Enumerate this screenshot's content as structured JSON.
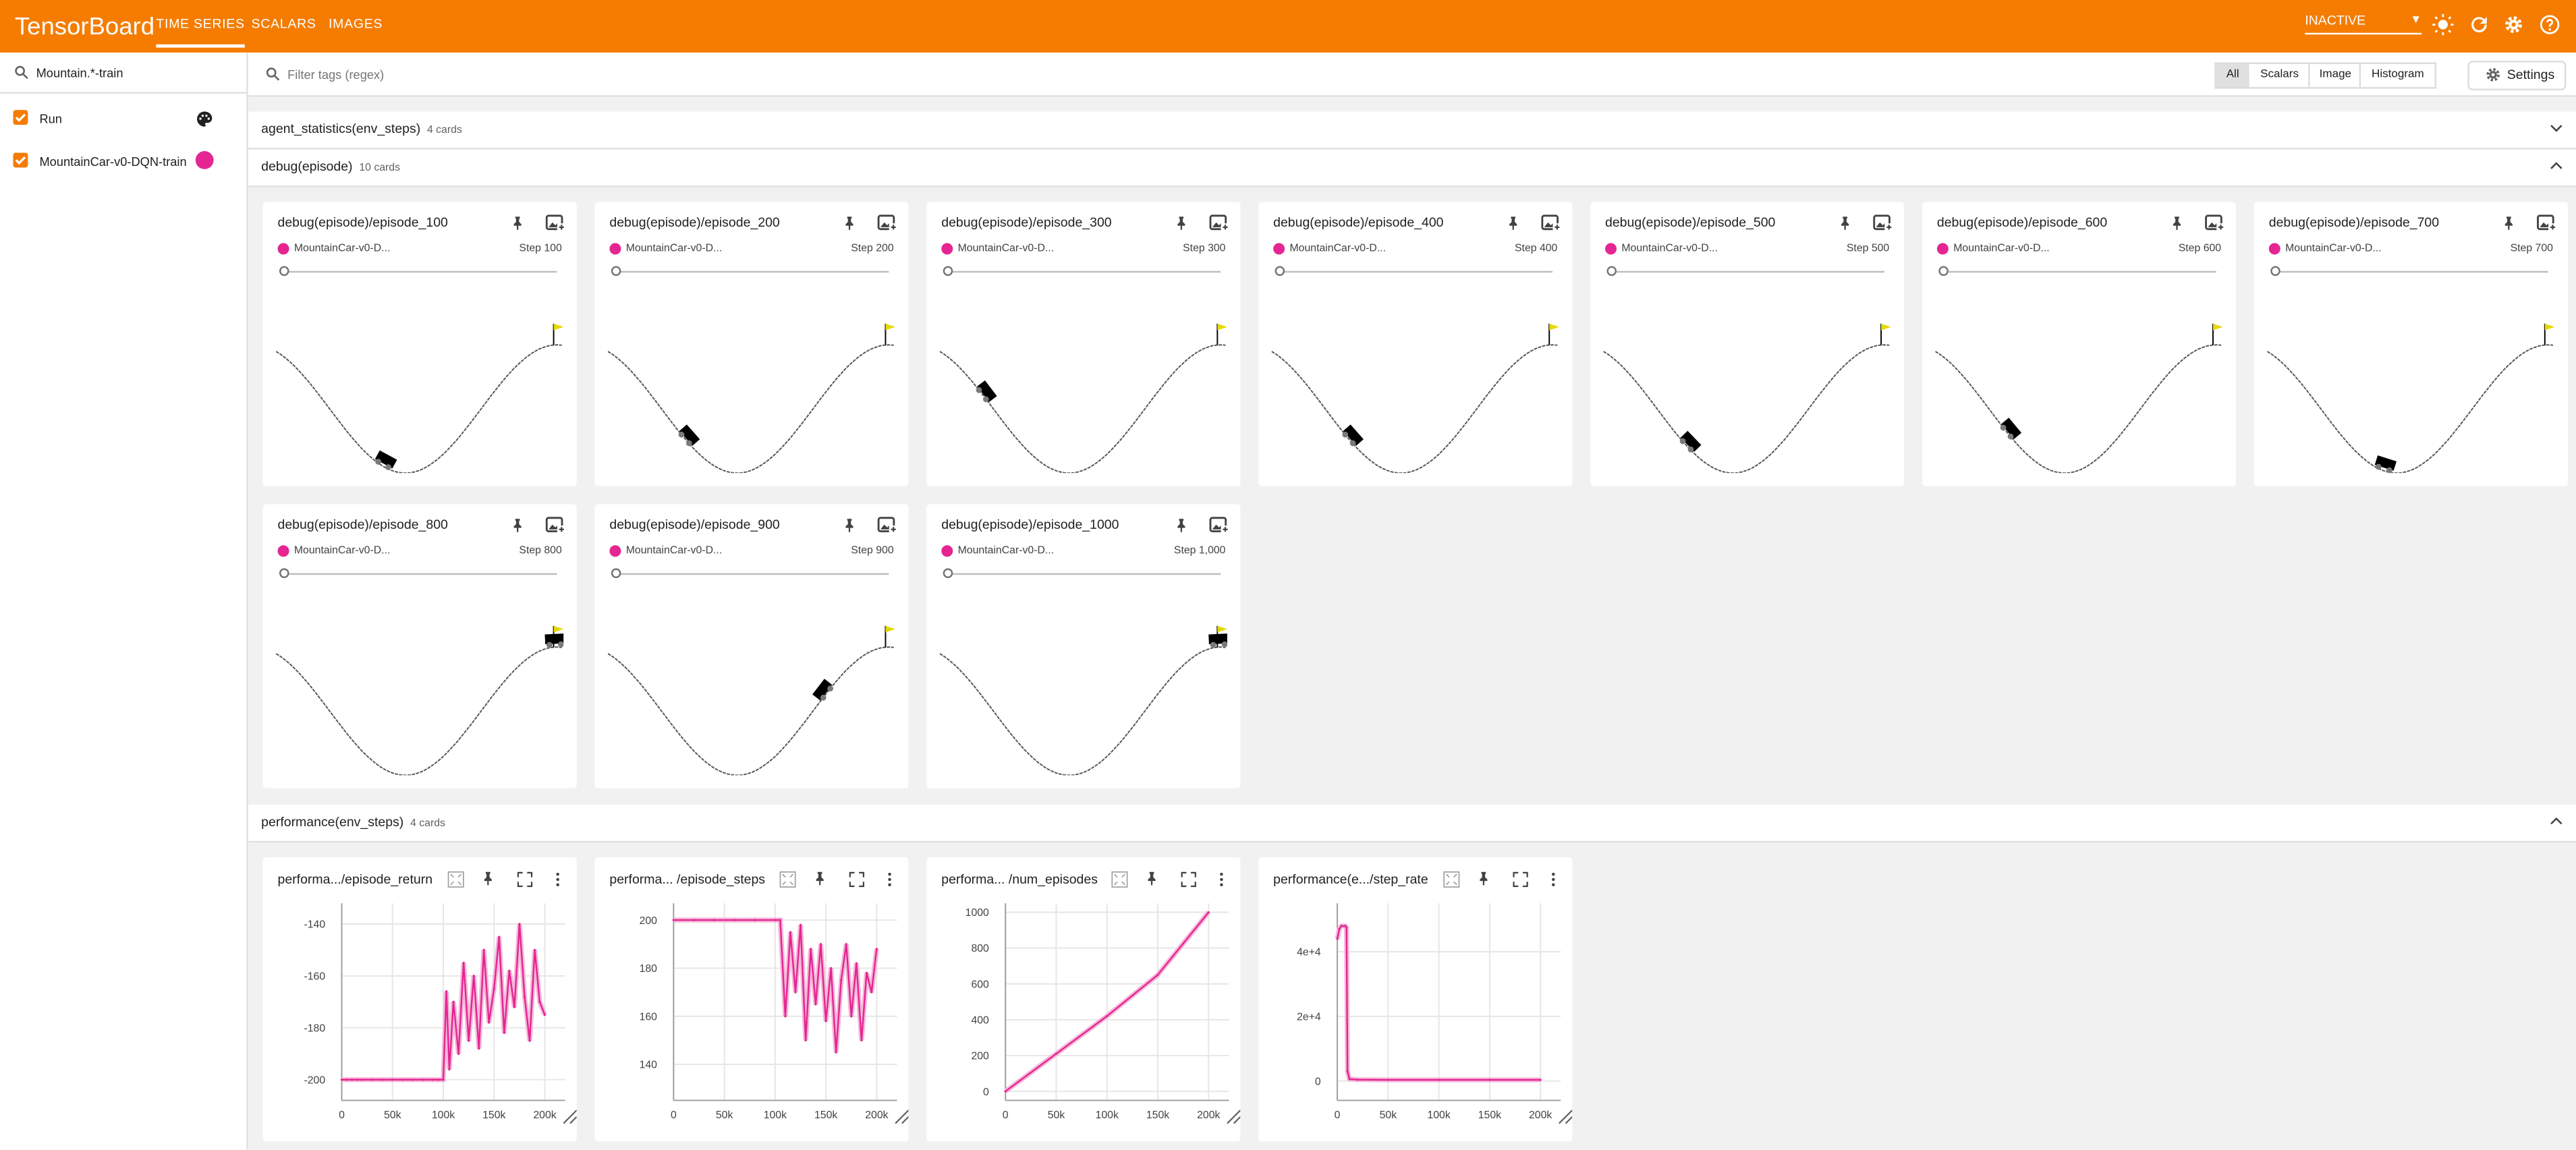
{
  "app": {
    "title": "TensorBoard"
  },
  "nav": {
    "tabs": [
      {
        "label": "TIME SERIES"
      },
      {
        "label": "SCALARS"
      },
      {
        "label": "IMAGES"
      }
    ]
  },
  "header": {
    "status_select": "INACTIVE"
  },
  "sidebar": {
    "run_filter_value": "Mountain.*-train",
    "runs": [
      {
        "label": "Run",
        "checked": true
      },
      {
        "label": "MountainCar-v0-DQN-train",
        "checked": true,
        "color": "#e52592"
      }
    ]
  },
  "filter": {
    "placeholder": "Filter tags (regex)",
    "toggles": [
      "All",
      "Scalars",
      "Image",
      "Histogram"
    ],
    "selected_toggle": "All",
    "settings_label": "Settings"
  },
  "sections": [
    {
      "title": "agent_statistics(env_steps)",
      "count": "4 cards",
      "expanded": false
    },
    {
      "title": "debug(episode)",
      "count": "10 cards",
      "expanded": true
    },
    {
      "title": "performance(env_steps)",
      "count": "4 cards",
      "expanded": true
    }
  ],
  "image_cards": [
    {
      "title": "debug(episode)/episode_100",
      "run": "MountainCar-v0-D...",
      "step": "Step 100",
      "car_fraction": 0.38
    },
    {
      "title": "debug(episode)/episode_200",
      "run": "MountainCar-v0-D...",
      "step": "Step 200",
      "car_fraction": 0.28
    },
    {
      "title": "debug(episode)/episode_300",
      "run": "MountainCar-v0-D...",
      "step": "Step 300",
      "car_fraction": 0.16
    },
    {
      "title": "debug(episode)/episode_400",
      "run": "MountainCar-v0-D...",
      "step": "Step 400",
      "car_fraction": 0.28
    },
    {
      "title": "debug(episode)/episode_500",
      "run": "MountainCar-v0-D...",
      "step": "Step 500",
      "car_fraction": 0.3
    },
    {
      "title": "debug(episode)/episode_600",
      "run": "MountainCar-v0-D...",
      "step": "Step 600",
      "car_fraction": 0.26
    },
    {
      "title": "debug(episode)/episode_700",
      "run": "MountainCar-v0-D...",
      "step": "Step 700",
      "car_fraction": 0.41
    },
    {
      "title": "debug(episode)/episode_800",
      "run": "MountainCar-v0-D...",
      "step": "Step 800",
      "car_fraction": 0.97
    },
    {
      "title": "debug(episode)/episode_900",
      "run": "MountainCar-v0-D...",
      "step": "Step 900",
      "car_fraction": 0.75
    },
    {
      "title": "debug(episode)/episode_1000",
      "run": "MountainCar-v0-D...",
      "step": "Step 1,000",
      "car_fraction": 0.97
    }
  ],
  "colors": {
    "accent": "#f57c00",
    "series": "#e52592",
    "series_light": "#f5b8d9"
  },
  "chart_data": [
    {
      "type": "line",
      "title": "performa.../episode_return",
      "x": [
        0,
        5000,
        10000,
        15000,
        20000,
        30000,
        40000,
        50000,
        60000,
        70000,
        80000,
        90000,
        95000,
        100000,
        103000,
        106000,
        110000,
        115000,
        120000,
        125000,
        130000,
        135000,
        140000,
        145000,
        150000,
        155000,
        160000,
        165000,
        170000,
        175000,
        180000,
        185000,
        190000,
        195000,
        200000
      ],
      "series": [
        {
          "values": [
            -200,
            -200,
            -200,
            -200,
            -200,
            -200,
            -200,
            -200,
            -200,
            -200,
            -200,
            -200,
            -200,
            -200,
            -166,
            -196,
            -170,
            -190,
            -155,
            -185,
            -160,
            -188,
            -150,
            -178,
            -165,
            -145,
            -182,
            -158,
            -172,
            -140,
            -168,
            -185,
            -150,
            -170,
            -175
          ]
        }
      ],
      "xticks": [
        "0",
        "50k",
        "100k",
        "150k",
        "200k"
      ],
      "yticks": [
        "-200",
        "-180",
        "-160",
        "-140"
      ],
      "xlim": [
        0,
        220000
      ],
      "ylim": [
        -208,
        -132
      ]
    },
    {
      "type": "line",
      "title": "performa... /episode_steps",
      "x": [
        0,
        20000,
        40000,
        60000,
        80000,
        100000,
        105000,
        110000,
        115000,
        120000,
        125000,
        130000,
        135000,
        140000,
        145000,
        150000,
        155000,
        160000,
        165000,
        170000,
        175000,
        180000,
        185000,
        190000,
        195000,
        200000
      ],
      "series": [
        {
          "values": [
            200,
            200,
            200,
            200,
            200,
            200,
            200,
            160,
            195,
            170,
            198,
            150,
            188,
            165,
            190,
            158,
            180,
            145,
            175,
            190,
            160,
            182,
            150,
            178,
            170,
            188
          ]
        }
      ],
      "xticks": [
        "0",
        "50k",
        "100k",
        "150k",
        "200k"
      ],
      "yticks": [
        "140",
        "160",
        "180",
        "200"
      ],
      "xlim": [
        0,
        220000
      ],
      "ylim": [
        125,
        207
      ]
    },
    {
      "type": "line",
      "title": "performa... /num_episodes",
      "x": [
        0,
        50000,
        100000,
        150000,
        200000
      ],
      "series": [
        {
          "values": [
            0,
            210,
            420,
            650,
            1000
          ]
        }
      ],
      "xticks": [
        "0",
        "50k",
        "100k",
        "150k",
        "200k"
      ],
      "yticks": [
        "0",
        "200",
        "400",
        "600",
        "800",
        "1000"
      ],
      "xlim": [
        0,
        220000
      ],
      "ylim": [
        -50,
        1050
      ]
    },
    {
      "type": "line",
      "title": "performance(e.../step_rate",
      "x": [
        0,
        2000,
        4000,
        8000,
        9000,
        10000,
        12000,
        20000,
        50000,
        100000,
        150000,
        200000
      ],
      "series": [
        {
          "values": [
            44000,
            47000,
            48000,
            48000,
            47500,
            3000,
            600,
            400,
            350,
            350,
            350,
            350
          ]
        }
      ],
      "xticks": [
        "0",
        "50k",
        "100k",
        "150k",
        "200k"
      ],
      "yticks": [
        "0",
        "2e+4",
        "4e+4"
      ],
      "xlim": [
        0,
        220000
      ],
      "ylim": [
        -6000,
        55000
      ]
    }
  ]
}
